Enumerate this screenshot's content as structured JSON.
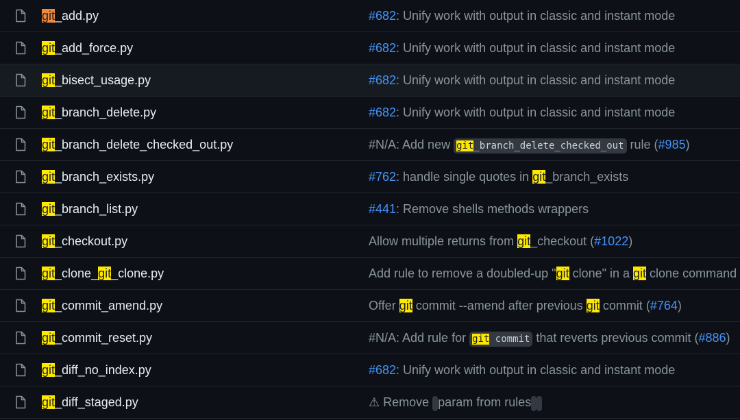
{
  "rows": [
    {
      "name": [
        {
          "t": "git",
          "hl": "cur"
        },
        {
          "t": "_add.py"
        }
      ],
      "commit": [
        {
          "t": "#682",
          "link": true
        },
        {
          "t": ": Unify work with output in classic and instant mode"
        }
      ]
    },
    {
      "name": [
        {
          "t": "git",
          "hl": true
        },
        {
          "t": "_add_force.py"
        }
      ],
      "commit": [
        {
          "t": "#682",
          "link": true
        },
        {
          "t": ": Unify work with output in classic and instant mode"
        }
      ]
    },
    {
      "name": [
        {
          "t": "git",
          "hl": true
        },
        {
          "t": "_bisect_usage.py"
        }
      ],
      "hover": true,
      "commit": [
        {
          "t": "#682",
          "link": true
        },
        {
          "t": ": Unify work with output in classic and instant mode"
        }
      ]
    },
    {
      "name": [
        {
          "t": "git",
          "hl": true
        },
        {
          "t": "_branch_delete.py"
        }
      ],
      "commit": [
        {
          "t": "#682",
          "link": true
        },
        {
          "t": ": Unify work with output in classic and instant mode"
        }
      ]
    },
    {
      "name": [
        {
          "t": "git",
          "hl": true
        },
        {
          "t": "_branch_delete_checked_out.py"
        }
      ],
      "commit": [
        {
          "t": "#N/A: Add new "
        },
        {
          "code": [
            {
              "t": "git",
              "hl": true
            },
            {
              "t": "_branch_delete_checked_out"
            }
          ]
        },
        {
          "t": " rule ("
        },
        {
          "t": "#985",
          "link": true
        },
        {
          "t": ")"
        }
      ]
    },
    {
      "name": [
        {
          "t": "git",
          "hl": true
        },
        {
          "t": "_branch_exists.py"
        }
      ],
      "commit": [
        {
          "t": "#762",
          "link": true
        },
        {
          "t": ": handle single quotes in "
        },
        {
          "t": "git",
          "hl": true
        },
        {
          "t": "_branch_exists"
        }
      ]
    },
    {
      "name": [
        {
          "t": "git",
          "hl": true
        },
        {
          "t": "_branch_list.py"
        }
      ],
      "commit": [
        {
          "t": "#441",
          "link": true
        },
        {
          "t": ": Remove shells methods wrappers"
        }
      ]
    },
    {
      "name": [
        {
          "t": "git",
          "hl": true
        },
        {
          "t": "_checkout.py"
        }
      ],
      "commit": [
        {
          "t": "Allow multiple returns from "
        },
        {
          "t": "git",
          "hl": true
        },
        {
          "t": "_checkout ("
        },
        {
          "t": "#1022",
          "link": true
        },
        {
          "t": ")"
        }
      ]
    },
    {
      "name": [
        {
          "t": "git",
          "hl": true
        },
        {
          "t": "_clone_"
        },
        {
          "t": "git",
          "hl": true
        },
        {
          "t": "_clone.py"
        }
      ],
      "commit": [
        {
          "t": "Add rule to remove a doubled-up \""
        },
        {
          "t": "git",
          "hl": true
        },
        {
          "t": " clone\" in a "
        },
        {
          "t": "git",
          "hl": true
        },
        {
          "t": " clone command"
        }
      ]
    },
    {
      "name": [
        {
          "t": "git",
          "hl": true
        },
        {
          "t": "_commit_amend.py"
        }
      ],
      "commit": [
        {
          "t": "Offer "
        },
        {
          "t": "git",
          "hl": true
        },
        {
          "t": " commit --amend after previous "
        },
        {
          "t": "git",
          "hl": true
        },
        {
          "t": " commit ("
        },
        {
          "t": "#764",
          "link": true
        },
        {
          "t": ")"
        }
      ]
    },
    {
      "name": [
        {
          "t": "git",
          "hl": true
        },
        {
          "t": "_commit_reset.py"
        }
      ],
      "commit": [
        {
          "t": "#N/A: Add rule for "
        },
        {
          "code": [
            {
              "t": "git",
              "hl": true
            },
            {
              "t": " commit"
            }
          ]
        },
        {
          "t": " that reverts previous commit ("
        },
        {
          "t": "#886",
          "link": true
        },
        {
          "t": ")"
        }
      ]
    },
    {
      "name": [
        {
          "t": "git",
          "hl": true
        },
        {
          "t": "_diff_no_index.py"
        }
      ],
      "commit": [
        {
          "t": "#682",
          "link": true
        },
        {
          "t": ": Unify work with output in classic and instant mode"
        }
      ]
    },
    {
      "name": [
        {
          "t": "git",
          "hl": true
        },
        {
          "t": "_diff_staged.py"
        }
      ],
      "commit": [
        {
          "t": "⚠ Remove "
        },
        {
          "code": [
            {
              "t": "    "
            }
          ]
        },
        {
          "t": " param from rules "
        },
        {
          "code": [
            {
              "t": "     "
            }
          ]
        },
        {
          "t": " "
        },
        {
          "code": [
            {
              "t": "              "
            }
          ]
        }
      ]
    }
  ],
  "icons": {
    "file": "file-icon"
  },
  "colors": {
    "background": "#0d1117",
    "highlight": "#ffe800",
    "current_highlight": "#f0883e",
    "link": "#4493f8"
  }
}
